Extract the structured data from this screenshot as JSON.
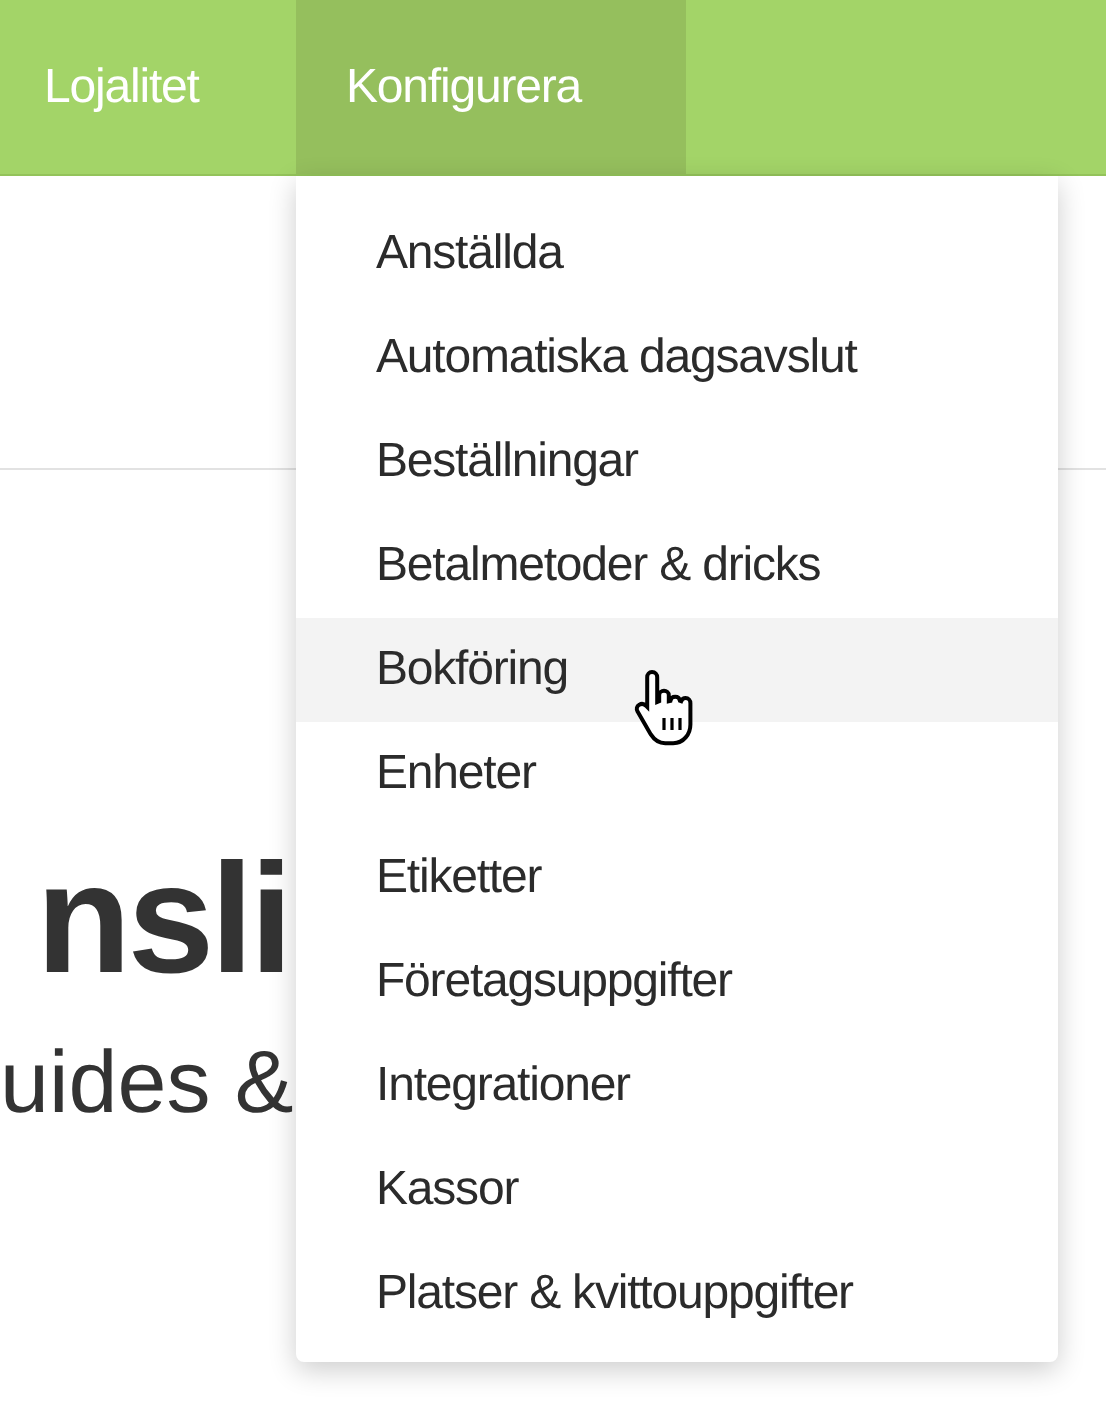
{
  "nav": [
    {
      "label": "Lojalitet",
      "selected": false
    },
    {
      "label": "Konfigurera",
      "selected": true
    }
  ],
  "dropdown": {
    "items": [
      {
        "label": "Anställda",
        "selected": false
      },
      {
        "label": "Automatiska dagsavslut",
        "selected": false
      },
      {
        "label": "Beställningar",
        "selected": false
      },
      {
        "label": "Betalmetoder & dricks",
        "selected": false
      },
      {
        "label": "Bokföring",
        "selected": true
      },
      {
        "label": "Enheter",
        "selected": false
      },
      {
        "label": "Etiketter",
        "selected": false
      },
      {
        "label": "Företagsuppgifter",
        "selected": false
      },
      {
        "label": "Integrationer",
        "selected": false
      },
      {
        "label": "Kassor",
        "selected": false
      },
      {
        "label": "Platser & kvittouppgifter",
        "selected": false
      }
    ]
  },
  "hero": {
    "title": "nsli",
    "subtitle": "uides &"
  }
}
